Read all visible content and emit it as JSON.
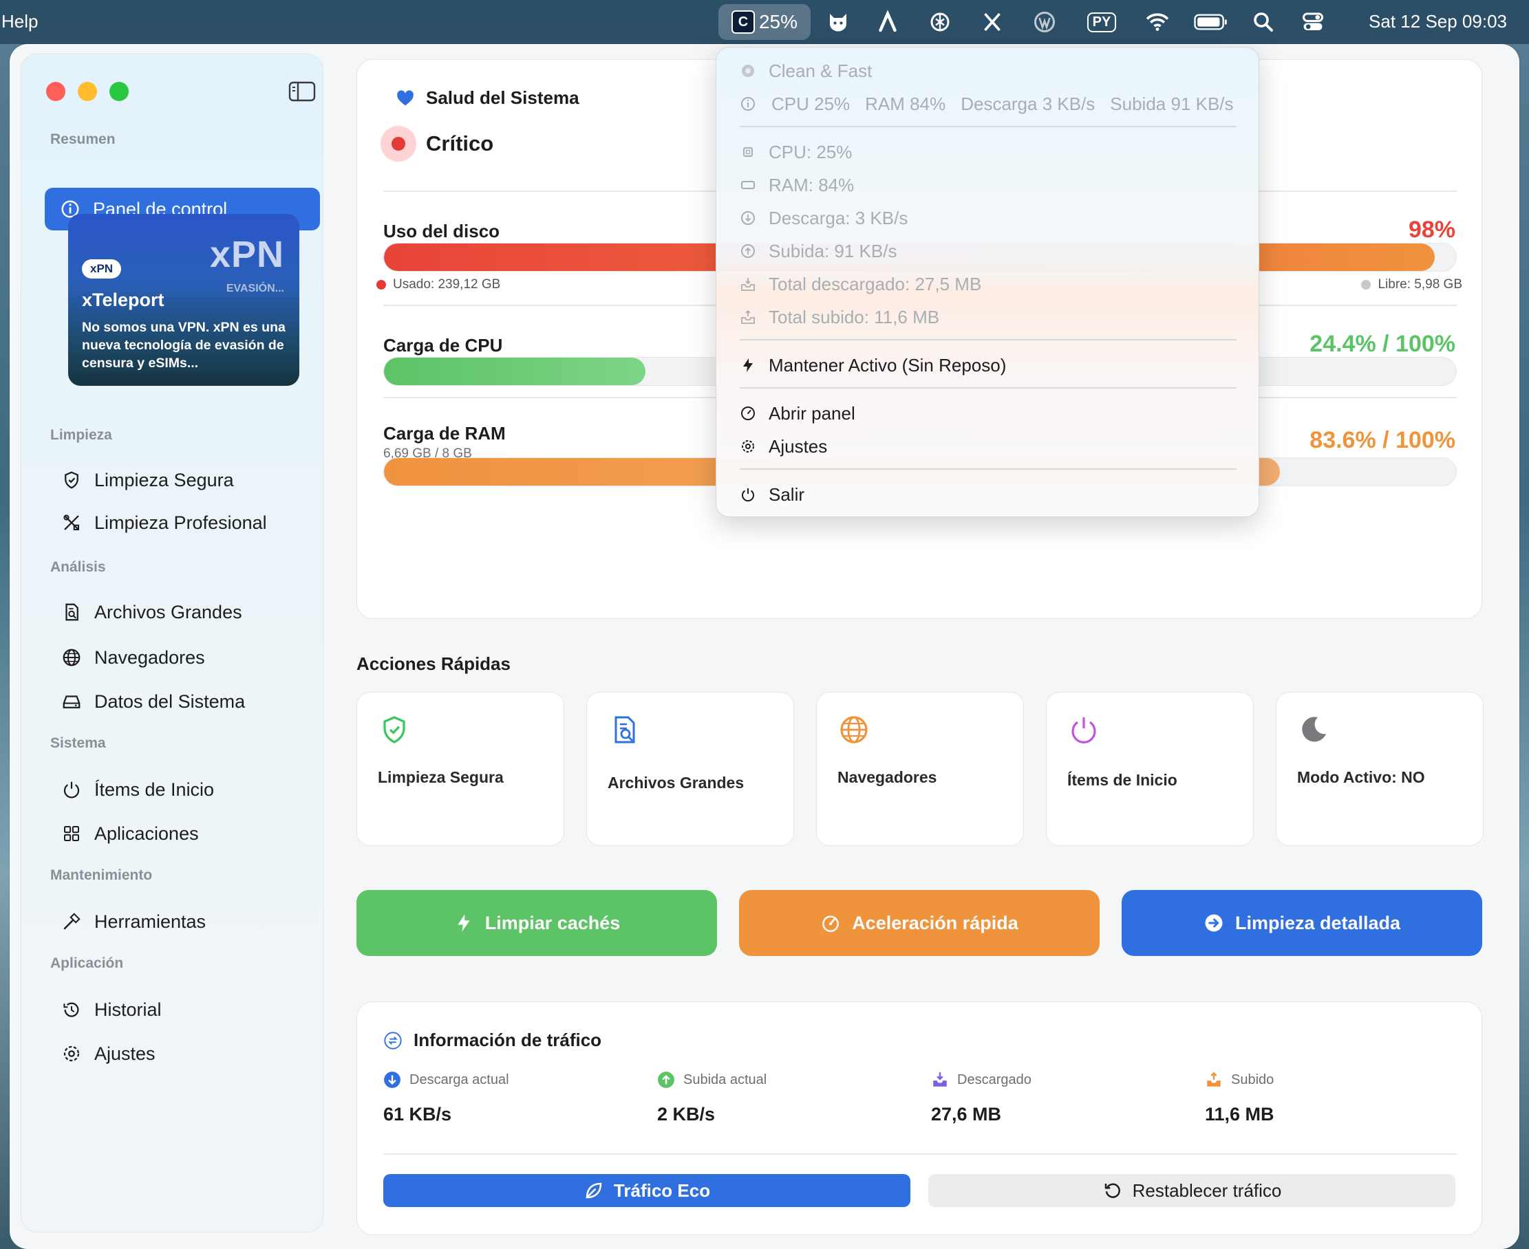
{
  "menubar": {
    "help": "Help",
    "cpu_percent": "25%",
    "lang_badge": "PY",
    "clock": "Sat 12 Sep  09:03"
  },
  "sidebar": {
    "sections": {
      "resumen": "Resumen",
      "limpieza": "Limpieza",
      "analisis": "Análisis",
      "sistema": "Sistema",
      "mantenimiento": "Mantenimiento",
      "aplicacion": "Aplicación"
    },
    "items": {
      "panel": "Panel de control",
      "limpieza_segura": "Limpieza Segura",
      "limpieza_profesional": "Limpieza Profesional",
      "archivos_grandes": "Archivos Grandes",
      "navegadores": "Navegadores",
      "datos_sistema": "Datos del Sistema",
      "items_inicio": "Ítems de Inicio",
      "aplicaciones": "Aplicaciones",
      "herramientas": "Herramientas",
      "historial": "Historial",
      "ajustes": "Ajustes"
    },
    "promo": {
      "brand": "xPN",
      "sub": "EVASIÓN...",
      "badge": "xPN",
      "title": "xTeleport",
      "desc": "No somos una VPN. xPN es una nueva tecnología de evasión de censura y eSIMs..."
    }
  },
  "health": {
    "title": "Salud del Sistema",
    "status": "Crítico",
    "disk": {
      "label": "Uso del disco",
      "value": "98%",
      "fill": 0.98,
      "used": "Usado: 239,12 GB",
      "free": "Libre: 5,98 GB"
    },
    "cpu": {
      "label": "Carga de CPU",
      "value": "24.4% / 100%",
      "fill": 0.244
    },
    "ram": {
      "label": "Carga de RAM",
      "sub": "6,69 GB / 8 GB",
      "value": "83.6% / 100%",
      "fill": 0.836
    }
  },
  "quick_actions": {
    "title": "Acciones Rápidas",
    "items": [
      "Limpieza Segura",
      "Archivos Grandes",
      "Navegadores",
      "Ítems de Inicio",
      "Modo Activo: NO"
    ]
  },
  "buttons": {
    "cache": "Limpiar cachés",
    "accel": "Aceleración rápida",
    "detail": "Limpieza detallada"
  },
  "traffic": {
    "title": "Información de tráfico",
    "stats": [
      {
        "label": "Descarga actual",
        "value": "61 KB/s"
      },
      {
        "label": "Subida actual",
        "value": "2 KB/s"
      },
      {
        "label": "Descargado",
        "value": "27,6 MB"
      },
      {
        "label": "Subido",
        "value": "11,6 MB"
      }
    ],
    "eco": "Tráfico Eco",
    "reset": "Restablecer tráfico"
  },
  "dropdown": {
    "app_name": "Clean & Fast",
    "stats": [
      "CPU 25%",
      "RAM 84%",
      "Descarga 3 KB/s",
      "Subida 91 KB/s"
    ],
    "cpu": "CPU: 25%",
    "ram": "RAM: 84%",
    "download": "Descarga: 3 KB/s",
    "upload": "Subida: 91 KB/s",
    "total_down": "Total descargado: 27,5 MB",
    "total_up": "Total subido: 11,6 MB",
    "keep_active": "Mantener Activo (Sin Reposo)",
    "open_panel": "Abrir panel",
    "settings": "Ajustes",
    "quit": "Salir"
  },
  "colors": {
    "accent_blue": "#2f6fe0",
    "red": "#e8443a",
    "green": "#5cc366",
    "orange": "#f0933d"
  }
}
